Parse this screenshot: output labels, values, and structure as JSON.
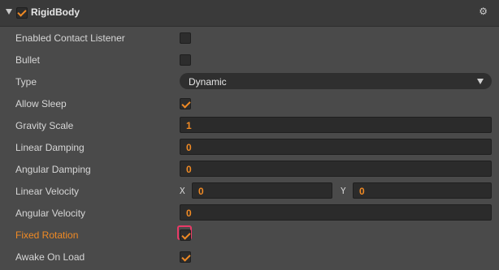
{
  "component": {
    "title": "RigidBody",
    "enabled": true,
    "gear_icon": "gear-icon"
  },
  "properties": {
    "enabled_contact_listener": {
      "label": "Enabled Contact Listener",
      "checked": false
    },
    "bullet": {
      "label": "Bullet",
      "checked": false
    },
    "type": {
      "label": "Type",
      "value": "Dynamic"
    },
    "allow_sleep": {
      "label": "Allow Sleep",
      "checked": true
    },
    "gravity_scale": {
      "label": "Gravity Scale",
      "value": "1"
    },
    "linear_damping": {
      "label": "Linear Damping",
      "value": "0"
    },
    "angular_damping": {
      "label": "Angular Damping",
      "value": "0"
    },
    "linear_velocity": {
      "label": "Linear Velocity",
      "x_label": "X",
      "x_value": "0",
      "y_label": "Y",
      "y_value": "0"
    },
    "angular_velocity": {
      "label": "Angular Velocity",
      "value": "0"
    },
    "fixed_rotation": {
      "label": "Fixed Rotation",
      "checked": true
    },
    "awake_on_load": {
      "label": "Awake On Load",
      "checked": true
    }
  },
  "colors": {
    "accent": "#f08a24",
    "focus_ring": "#e83a67",
    "panel_bg": "#4a4a4a",
    "header_bg": "#3a3a3a"
  }
}
